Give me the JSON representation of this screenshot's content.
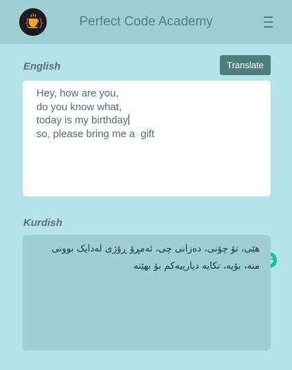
{
  "header": {
    "title": "Perfect Code Academy",
    "logo_icon": "coffee-cup-braces-icon",
    "menu_icon": "hamburger-menu-icon"
  },
  "source": {
    "label": "English",
    "button_label": "Translate",
    "lines": [
      "Hey, how are you,",
      "do you know what,",
      "today is my birthday",
      "so, please bring me a  gift"
    ],
    "assistant_icon": "grammarly-icon"
  },
  "target": {
    "label": "Kurdish",
    "text": "هێی، تۆ چۆنی، دەزانی چی،  ئەمڕۆ ڕۆژی لەدایک بوونی منە،  بۆیە، تکایە دیارییەکم  بۆ بهێنە"
  },
  "colors": {
    "background": "#b5e4e8",
    "header": "#9ecfd4",
    "button": "#4f7f7c",
    "output_box": "#9ecfd4",
    "grammarly": "#15c39a"
  }
}
